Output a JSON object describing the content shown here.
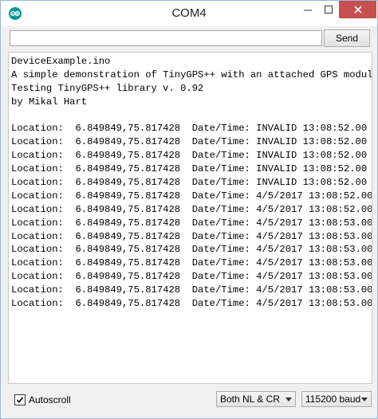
{
  "window": {
    "title": "COM4"
  },
  "input": {
    "value": "",
    "placeholder": ""
  },
  "send_label": "Send",
  "output_lines": [
    "DeviceExample.ino",
    "A simple demonstration of TinyGPS++ with an attached GPS module",
    "Testing TinyGPS++ library v. 0.92",
    "by Mikal Hart",
    "",
    "Location:  6.849849,75.817428  Date/Time: INVALID 13:08:52.00",
    "Location:  6.849849,75.817428  Date/Time: INVALID 13:08:52.00",
    "Location:  6.849849,75.817428  Date/Time: INVALID 13:08:52.00",
    "Location:  6.849849,75.817428  Date/Time: INVALID 13:08:52.00",
    "Location:  6.849849,75.817428  Date/Time: INVALID 13:08:52.00",
    "Location:  6.849849,75.817428  Date/Time: 4/5/2017 13:08:52.00",
    "Location:  6.849849,75.817428  Date/Time: 4/5/2017 13:08:52.00",
    "Location:  6.849849,75.817428  Date/Time: 4/5/2017 13:08:53.00",
    "Location:  6.849849,75.817428  Date/Time: 4/5/2017 13:08:53.00",
    "Location:  6.849849,75.817428  Date/Time: 4/5/2017 13:08:53.00",
    "Location:  6.849849,75.817428  Date/Time: 4/5/2017 13:08:53.00",
    "Location:  6.849849,75.817428  Date/Time: 4/5/2017 13:08:53.00",
    "Location:  6.849849,75.817428  Date/Time: 4/5/2017 13:08:53.00",
    "Location:  6.849849,75.817428  Date/Time: 4/5/2017 13:08:53.00"
  ],
  "bottom": {
    "autoscroll_label": "Autoscroll",
    "autoscroll_checked": true,
    "line_ending": "Both NL & CR",
    "baud_rate": "115200 baud"
  },
  "icons": {
    "app": "arduino-icon",
    "minimize": "minimize-icon",
    "maximize": "maximize-icon",
    "close": "close-icon",
    "checkbox": "checkmark-icon"
  },
  "colors": {
    "close_button": "#c74f4f",
    "arduino_teal": "#00979c"
  }
}
